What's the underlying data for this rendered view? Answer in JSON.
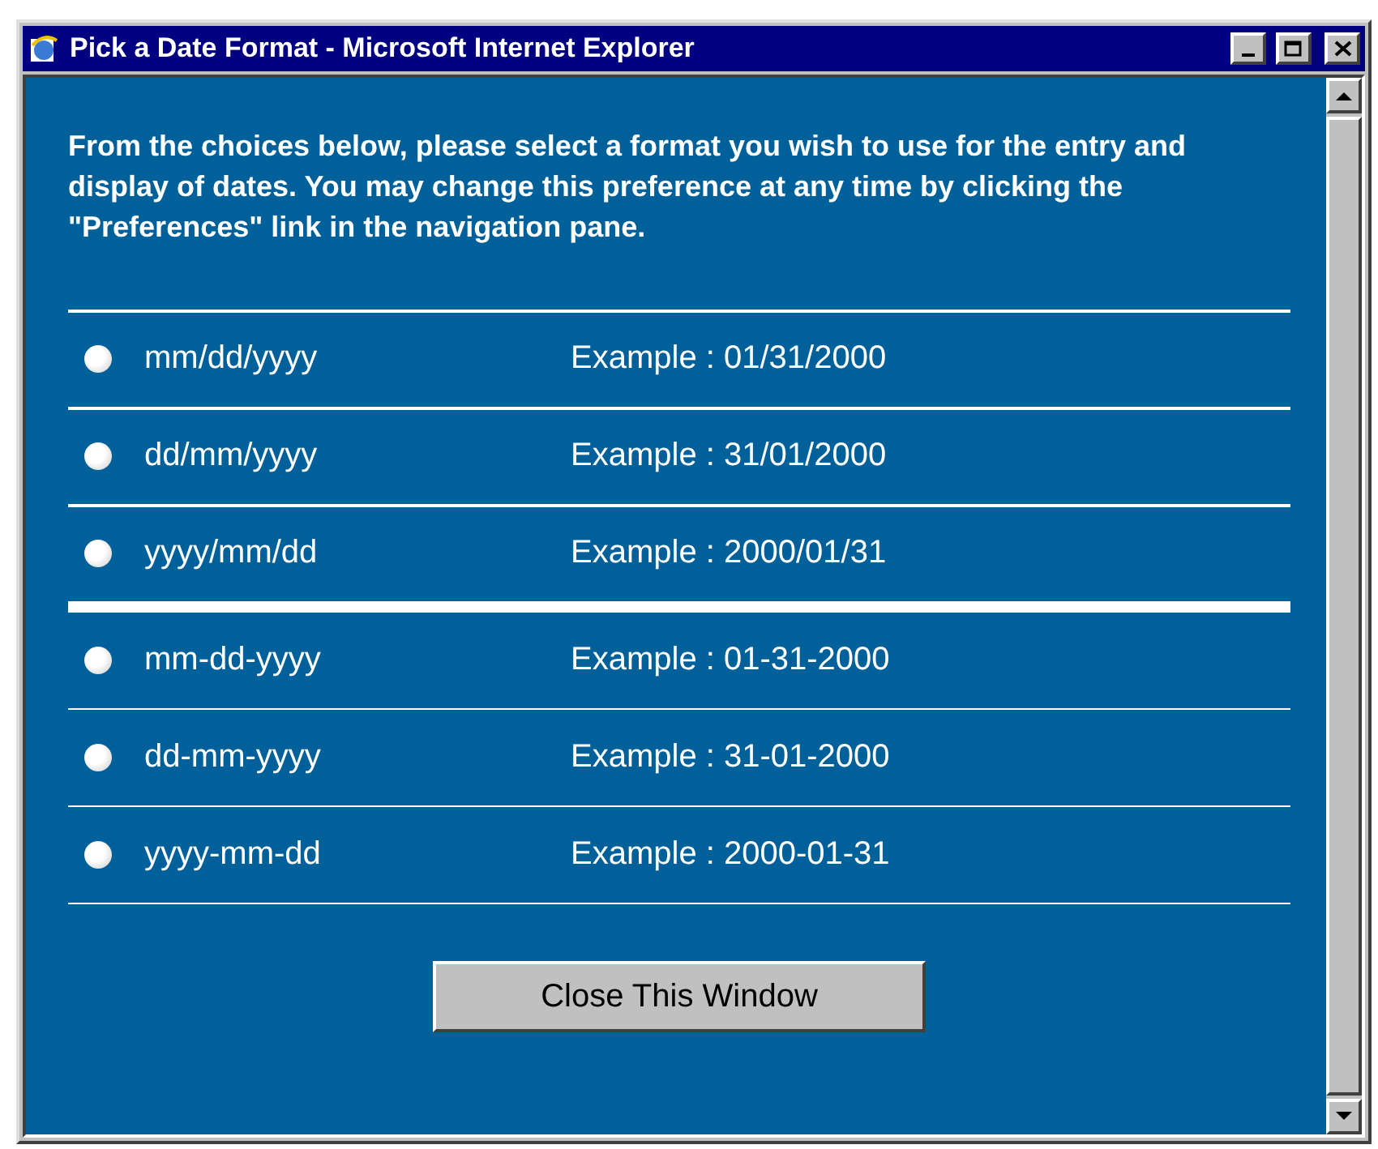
{
  "window": {
    "title": "Pick a Date Format - Microsoft Internet Explorer"
  },
  "intro": "From the choices below, please select a format you wish to use for the entry and display of dates. You may change this preference at any time by clicking the \"Preferences\" link in the navigation pane.",
  "groups": [
    [
      {
        "format": "mm/dd/yyyy",
        "example": "Example : 01/31/2000",
        "selected": false
      },
      {
        "format": "dd/mm/yyyy",
        "example": "Example : 31/01/2000",
        "selected": false
      },
      {
        "format": "yyyy/mm/dd",
        "example": "Example : 2000/01/31",
        "selected": false
      }
    ],
    [
      {
        "format": "mm-dd-yyyy",
        "example": "Example : 01-31-2000",
        "selected": false
      },
      {
        "format": "dd-mm-yyyy",
        "example": "Example : 31-01-2000",
        "selected": false
      },
      {
        "format": "yyyy-mm-dd",
        "example": "Example : 2000-01-31",
        "selected": false
      }
    ]
  ],
  "close_button": "Close This Window"
}
